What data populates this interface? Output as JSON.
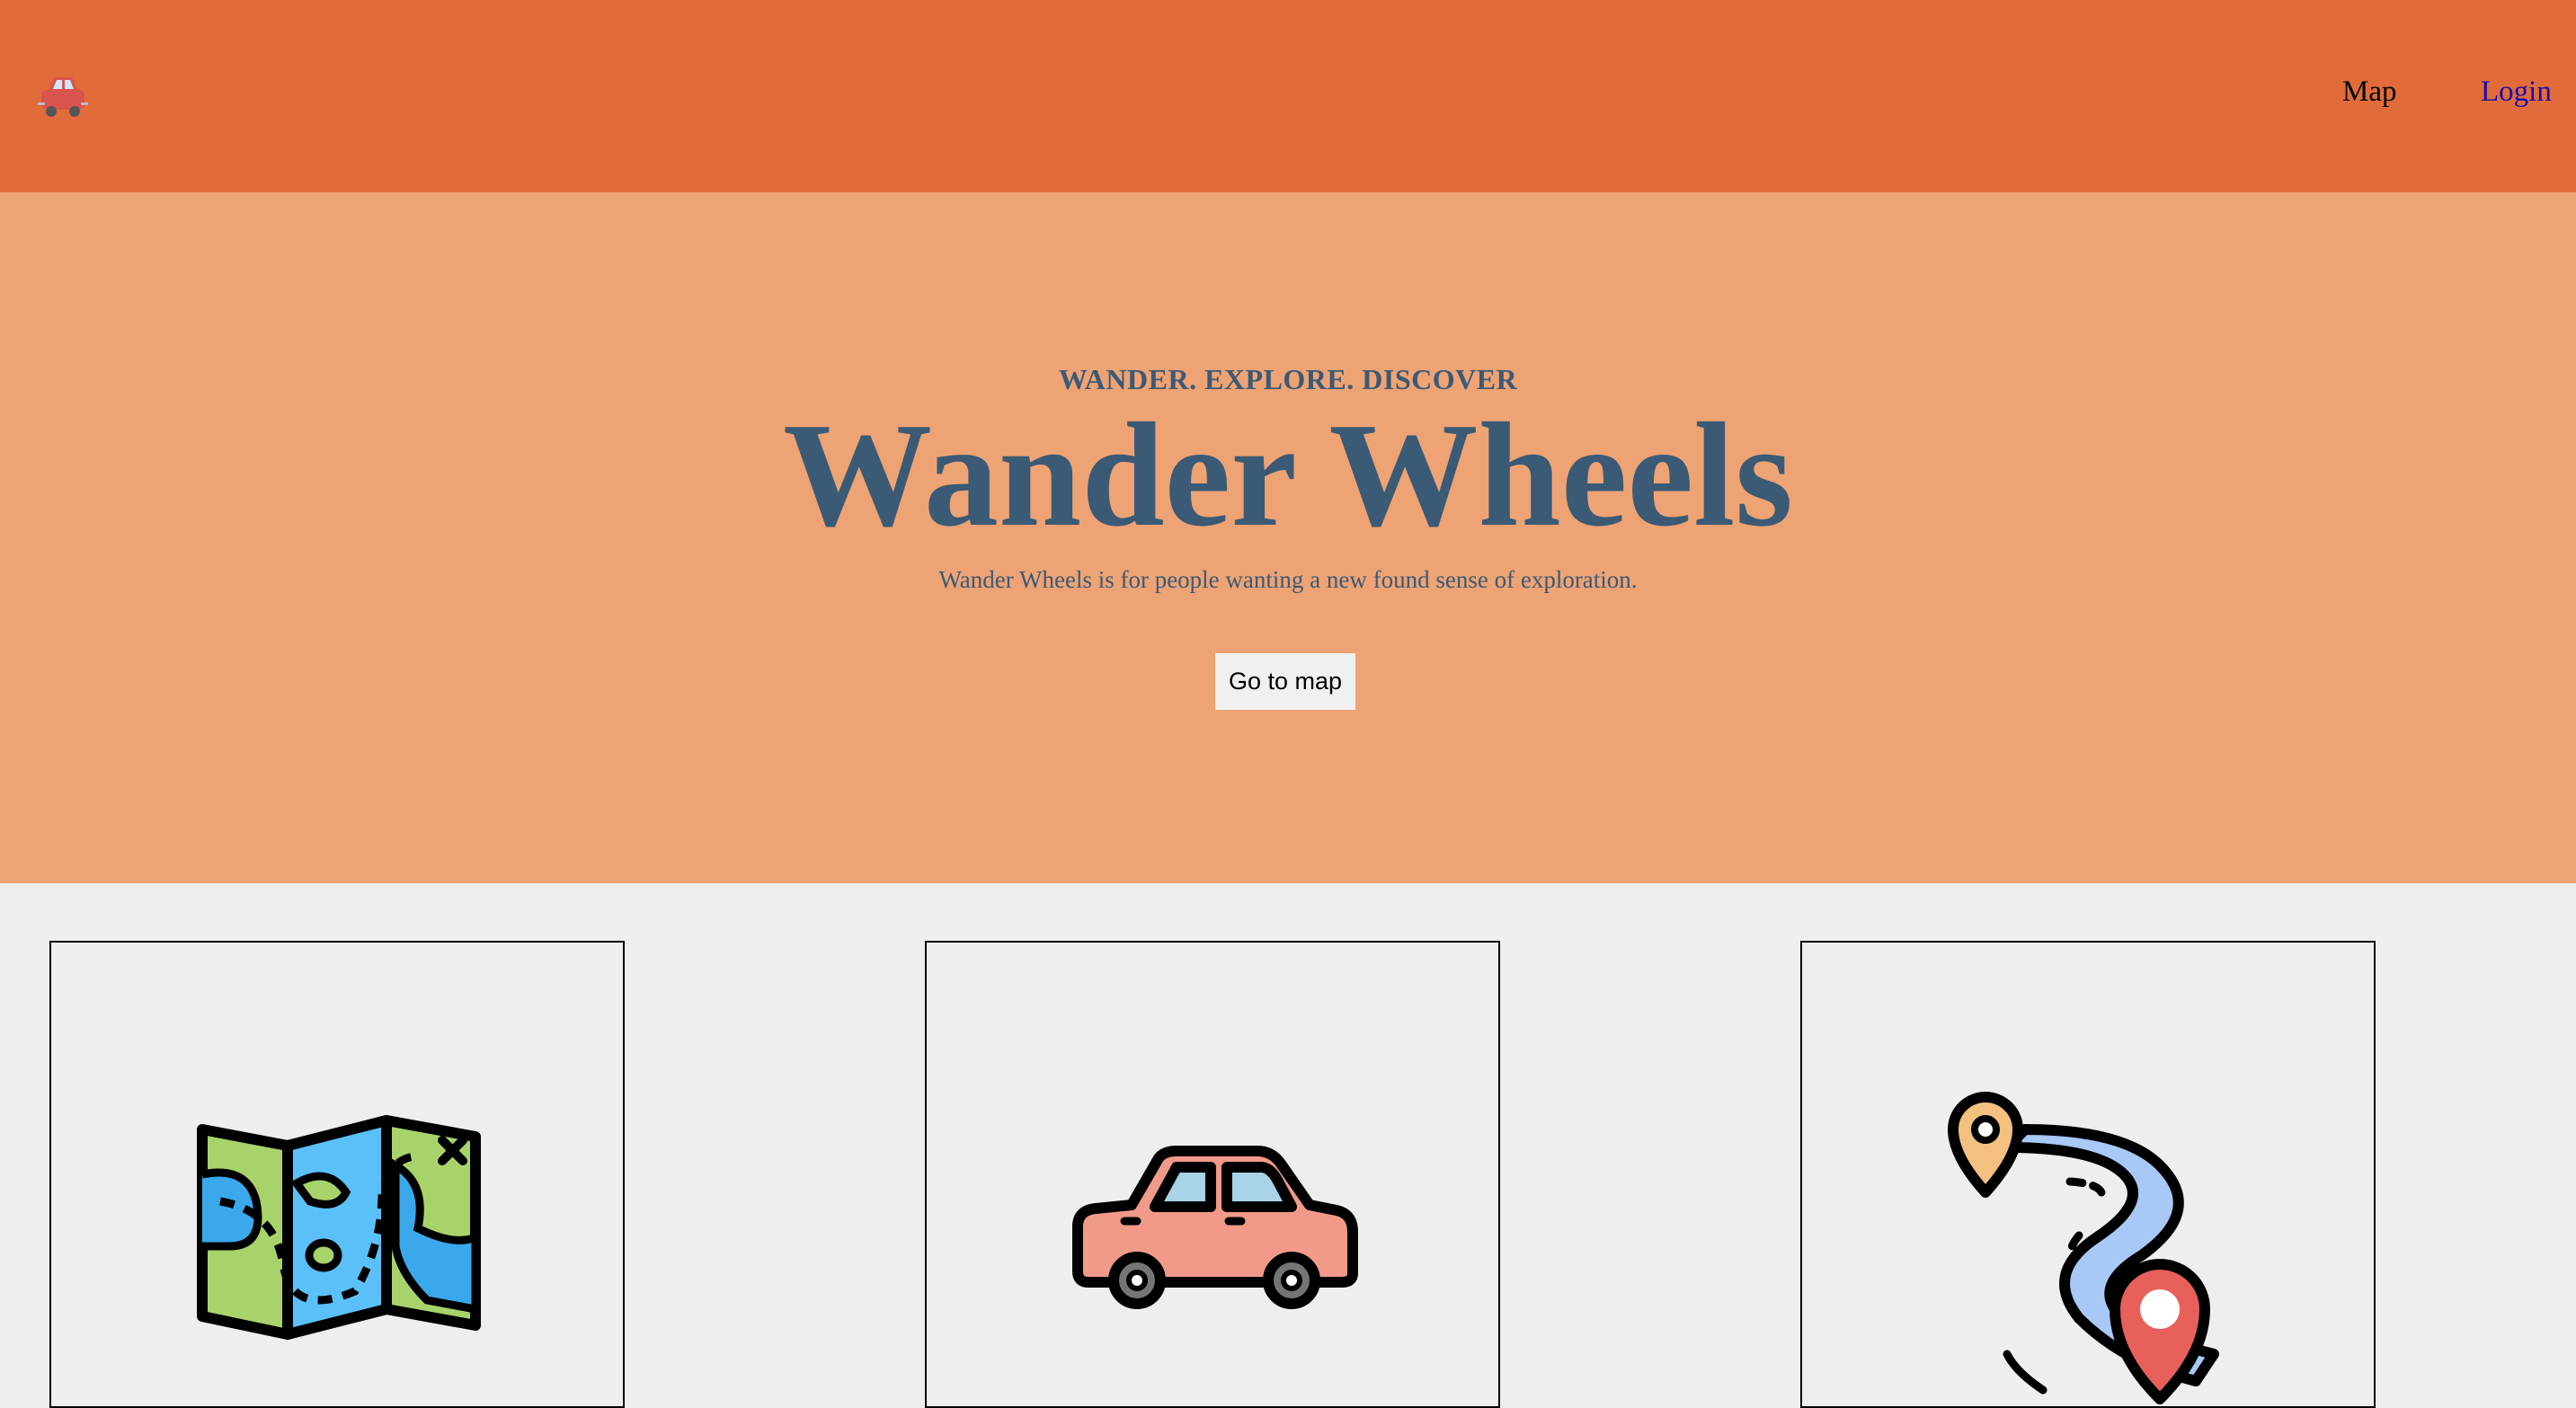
{
  "header": {
    "logo_icon": "car-icon",
    "nav": [
      {
        "label": "Map"
      },
      {
        "label": "Login"
      }
    ]
  },
  "hero": {
    "eyebrow": "WANDER. EXPLORE. DISCOVER",
    "title": "Wander Wheels",
    "subtitle": "Wander Wheels is for people wanting a new found sense of exploration.",
    "cta_label": "Go to map"
  },
  "cards": [
    {
      "icon": "folded-map-icon"
    },
    {
      "icon": "car-icon"
    },
    {
      "icon": "route-pins-icon"
    }
  ],
  "colors": {
    "header_bg": "#e16c3a",
    "hero_bg": "#eea374",
    "hero_text": "#3b5a75",
    "page_bg": "#eeeeee",
    "login_link": "#1a0dab"
  }
}
